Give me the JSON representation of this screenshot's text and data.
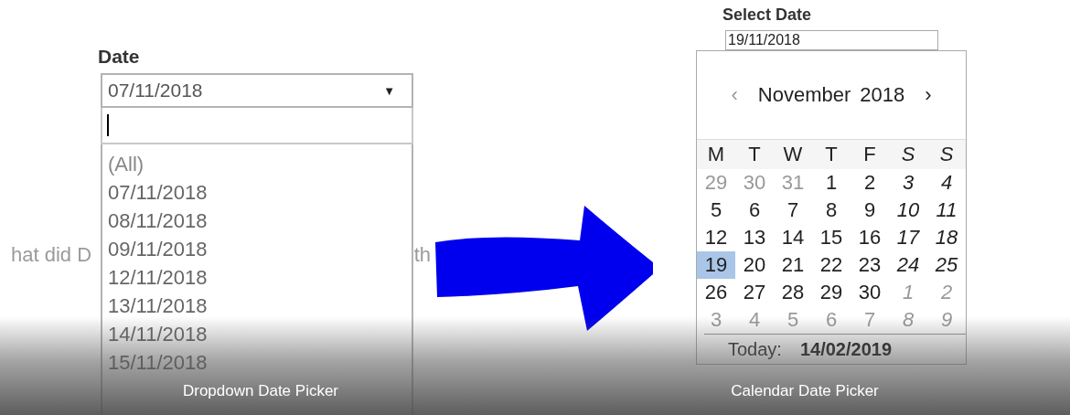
{
  "background_text": [
    "hat did D",
    "th"
  ],
  "dropdown_picker": {
    "label": "Date",
    "value": "07/11/2018",
    "expand_glyph": "▼",
    "items": [
      {
        "label": "(All)",
        "kind": "all"
      },
      {
        "label": "07/11/2018",
        "kind": "date"
      },
      {
        "label": "08/11/2018",
        "kind": "date"
      },
      {
        "label": "09/11/2018",
        "kind": "date"
      },
      {
        "label": "12/11/2018",
        "kind": "date"
      },
      {
        "label": "13/11/2018",
        "kind": "date"
      },
      {
        "label": "14/11/2018",
        "kind": "date"
      },
      {
        "label": "15/11/2018",
        "kind": "date"
      }
    ]
  },
  "calendar_picker": {
    "label": "Select Date",
    "value": "19/11/2018",
    "prev": "‹",
    "next": "›",
    "month": "November",
    "year": "2018",
    "weekdays": [
      {
        "label": "M",
        "weekend": false
      },
      {
        "label": "T",
        "weekend": false
      },
      {
        "label": "W",
        "weekend": false
      },
      {
        "label": "T",
        "weekend": false
      },
      {
        "label": "F",
        "weekend": false
      },
      {
        "label": "S",
        "weekend": true
      },
      {
        "label": "S",
        "weekend": true
      }
    ],
    "weeks": [
      [
        {
          "day": "29",
          "muted": true,
          "selected": false
        },
        {
          "day": "30",
          "muted": true,
          "selected": false
        },
        {
          "day": "31",
          "muted": true,
          "selected": false
        },
        {
          "day": "1",
          "muted": false,
          "selected": false
        },
        {
          "day": "2",
          "muted": false,
          "selected": false
        },
        {
          "day": "3",
          "muted": false,
          "selected": false
        },
        {
          "day": "4",
          "muted": false,
          "selected": false
        }
      ],
      [
        {
          "day": "5",
          "muted": false,
          "selected": false
        },
        {
          "day": "6",
          "muted": false,
          "selected": false
        },
        {
          "day": "7",
          "muted": false,
          "selected": false
        },
        {
          "day": "8",
          "muted": false,
          "selected": false
        },
        {
          "day": "9",
          "muted": false,
          "selected": false
        },
        {
          "day": "10",
          "muted": false,
          "selected": false
        },
        {
          "day": "11",
          "muted": false,
          "selected": false
        }
      ],
      [
        {
          "day": "12",
          "muted": false,
          "selected": false
        },
        {
          "day": "13",
          "muted": false,
          "selected": false
        },
        {
          "day": "14",
          "muted": false,
          "selected": false
        },
        {
          "day": "15",
          "muted": false,
          "selected": false
        },
        {
          "day": "16",
          "muted": false,
          "selected": false
        },
        {
          "day": "17",
          "muted": false,
          "selected": false
        },
        {
          "day": "18",
          "muted": false,
          "selected": false
        }
      ],
      [
        {
          "day": "19",
          "muted": false,
          "selected": true
        },
        {
          "day": "20",
          "muted": false,
          "selected": false
        },
        {
          "day": "21",
          "muted": false,
          "selected": false
        },
        {
          "day": "22",
          "muted": false,
          "selected": false
        },
        {
          "day": "23",
          "muted": false,
          "selected": false
        },
        {
          "day": "24",
          "muted": false,
          "selected": false
        },
        {
          "day": "25",
          "muted": false,
          "selected": false
        }
      ],
      [
        {
          "day": "26",
          "muted": false,
          "selected": false
        },
        {
          "day": "27",
          "muted": false,
          "selected": false
        },
        {
          "day": "28",
          "muted": false,
          "selected": false
        },
        {
          "day": "29",
          "muted": false,
          "selected": false
        },
        {
          "day": "30",
          "muted": false,
          "selected": false
        },
        {
          "day": "1",
          "muted": true,
          "selected": false
        },
        {
          "day": "2",
          "muted": true,
          "selected": false
        }
      ],
      [
        {
          "day": "3",
          "muted": true,
          "selected": false
        },
        {
          "day": "4",
          "muted": true,
          "selected": false
        },
        {
          "day": "5",
          "muted": true,
          "selected": false
        },
        {
          "day": "6",
          "muted": true,
          "selected": false
        },
        {
          "day": "7",
          "muted": true,
          "selected": false
        },
        {
          "day": "8",
          "muted": true,
          "selected": false
        },
        {
          "day": "9",
          "muted": true,
          "selected": false
        }
      ]
    ],
    "today_label": "Today:",
    "today_value": "14/02/2019"
  },
  "captions": [
    "Dropdown Date Picker",
    "Calendar Date Picker"
  ]
}
